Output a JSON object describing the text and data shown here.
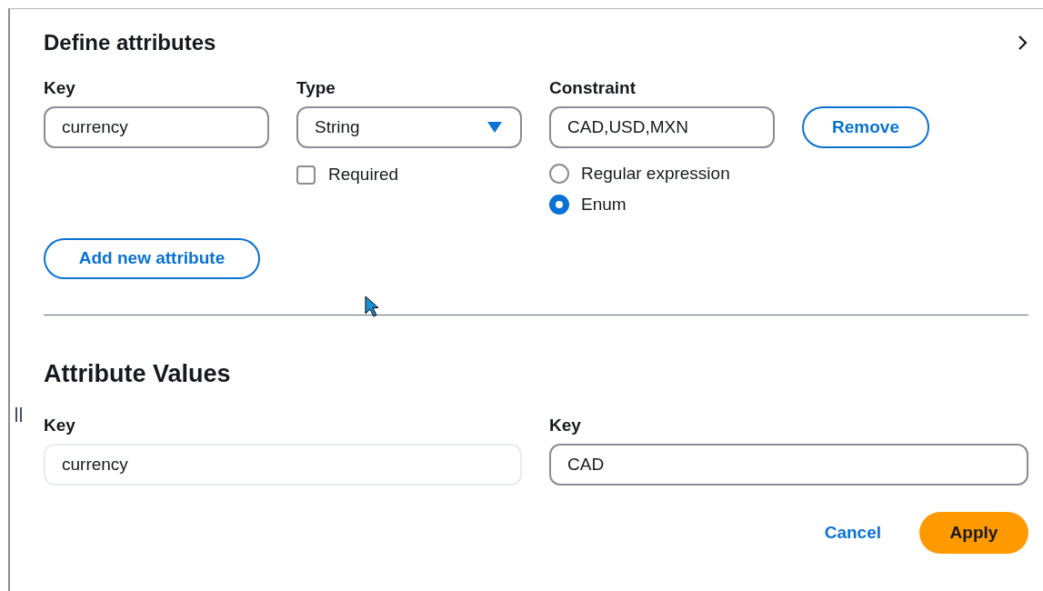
{
  "title": "Define attributes",
  "attributes": [
    {
      "key_label": "Key",
      "key": "currency",
      "type_label": "Type",
      "type": "String",
      "required_label": "Required",
      "required": false,
      "constraint_label": "Constraint",
      "constraint": "CAD,USD,MXN",
      "constraint_options": [
        {
          "label": "Regular expression",
          "selected": false
        },
        {
          "label": "Enum",
          "selected": true
        }
      ],
      "remove_button": "Remove"
    }
  ],
  "add_button": "Add new attribute",
  "values_section": {
    "title": "Attribute Values",
    "fields": [
      {
        "label": "Key",
        "value": "currency",
        "disabled": true
      },
      {
        "label": "Key",
        "value": "CAD",
        "disabled": false
      }
    ]
  },
  "buttons": [
    {
      "label": "Cancel",
      "kind": "link"
    },
    {
      "label": "Apply",
      "kind": "primary"
    }
  ]
}
